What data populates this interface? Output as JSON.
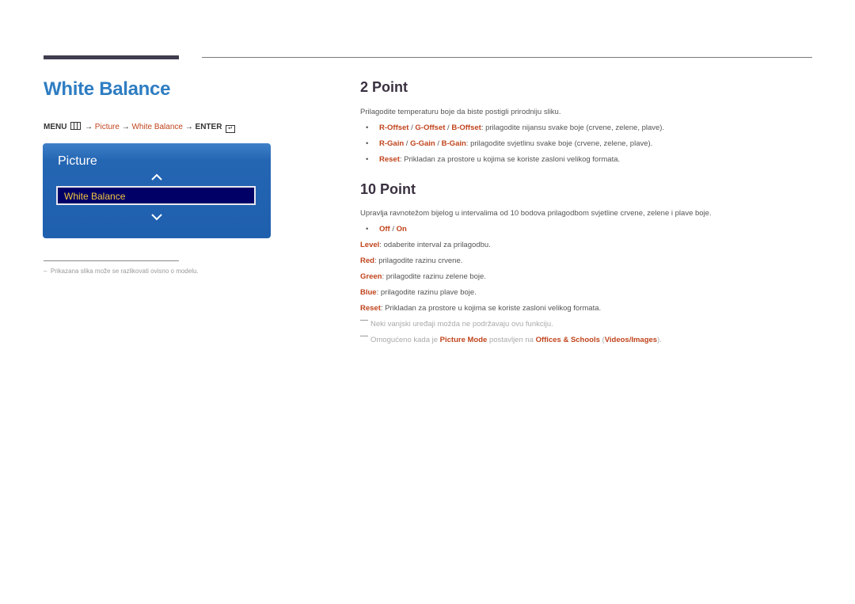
{
  "header": {
    "title": "White Balance",
    "menu_path": {
      "menu": "MENU",
      "arrow": "→",
      "step1": "Picture",
      "step2": "White Balance",
      "enter": "ENTER",
      "menu_icon": "menu-grid-icon",
      "enter_icon": "enter-icon"
    }
  },
  "osd": {
    "title": "Picture",
    "selected_item": "White Balance",
    "up_icon": "chevron-up-icon",
    "down_icon": "chevron-down-icon",
    "colors": {
      "panel": "#1e5fae",
      "selected_bg": "#000066",
      "selected_text": "#f5c842"
    }
  },
  "footnote": "Prikazana slika može se razlikovati ovisno o modelu.",
  "two_point": {
    "heading": "2 Point",
    "intro": "Prilagodite temperaturu boje da biste postigli prirodniju sliku.",
    "bullets": [
      {
        "terms": [
          "R-Offset",
          "G-Offset",
          "B-Offset"
        ],
        "text": ": prilagodite nijansu svake boje (crvene, zelene, plave)."
      },
      {
        "terms": [
          "R-Gain",
          "G-Gain",
          "B-Gain"
        ],
        "text": ": prilagodite svjetlinu svake boje (crvene, zelene, plave)."
      },
      {
        "terms": [
          "Reset"
        ],
        "text": ": Prikladan za prostore u kojima se koriste zasloni velikog formata."
      }
    ]
  },
  "ten_point": {
    "heading": "10 Point",
    "intro": "Upravlja ravnotežom bijelog u intervalima od 10 bodova prilagodbom svjetline crvene, zelene i plave boje.",
    "toggle": {
      "off": "Off",
      "on": "On",
      "sep": " / "
    },
    "items": [
      {
        "term": "Level",
        "text": ": odaberite interval za prilagodbu."
      },
      {
        "term": "Red",
        "text": ": prilagodite razinu crvene."
      },
      {
        "term": "Green",
        "text": ": prilagodite razinu zelene boje."
      },
      {
        "term": "Blue",
        "text": ": prilagodite razinu plave boje."
      },
      {
        "term": "Reset",
        "text": ": Prikladan za prostore u kojima se koriste zasloni velikog formata."
      }
    ],
    "notes": [
      {
        "text": "Neki vanjski uređaji možda ne podržavaju ovu funkciju."
      },
      {
        "pre": "Omogućeno kada je ",
        "term1": "Picture Mode",
        "mid": " postavljen na ",
        "term2": "Offices & Schools",
        "open": " (",
        "term3": "Videos/Images",
        "close": ")."
      }
    ]
  },
  "colors": {
    "title_blue": "#2e7dc2",
    "accent_orange": "#c0441d",
    "heading_dark": "#3a3040"
  }
}
